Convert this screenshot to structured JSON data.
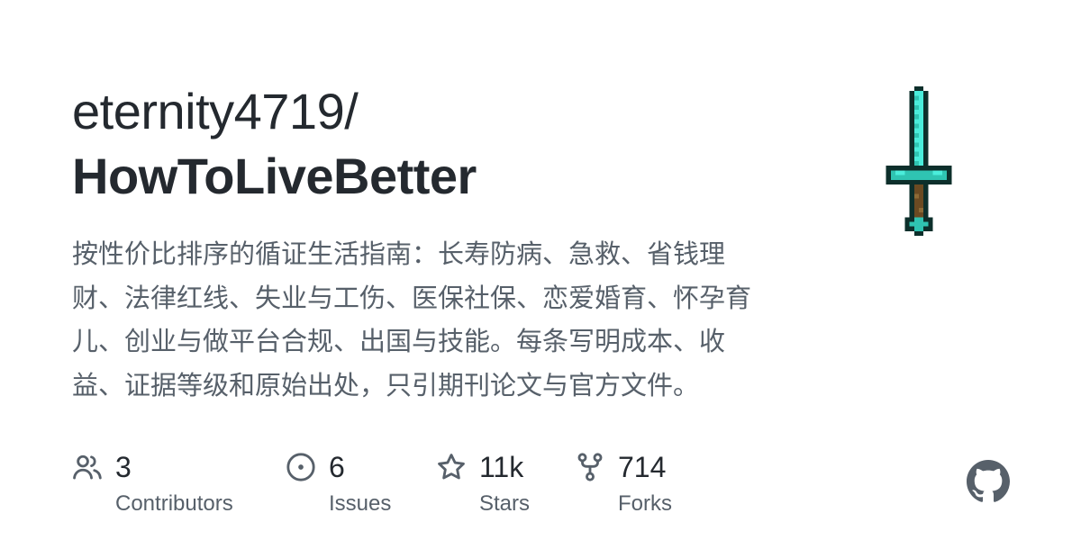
{
  "repo": {
    "owner": "eternity4719/",
    "name": "HowToLiveBetter",
    "description": "按性价比排序的循证生活指南：长寿防病、急救、省钱理财、法律红线、失业与工伤、医保社保、恋爱婚育、怀孕育儿、创业与做平台合规、出国与技能。每条写明成本、收益、证据等级和原始出处，只引期刊论文与官方文件。"
  },
  "stats": [
    {
      "icon": "people-icon",
      "count": "3",
      "label": "Contributors"
    },
    {
      "icon": "issue-opened-icon",
      "count": "6",
      "label": "Issues"
    },
    {
      "icon": "star-icon",
      "count": "11k",
      "label": "Stars"
    },
    {
      "icon": "repo-forked-icon",
      "count": "714",
      "label": "Forks"
    }
  ],
  "colors": {
    "text_primary": "#24292f",
    "text_secondary": "#57606a",
    "icon": "#57606a",
    "sword_blade": "#4aeddb",
    "sword_outline": "#0d2f2b",
    "sword_handle": "#6b4a22"
  },
  "images": {
    "repo_avatar": "diamond-sword-pixel-art",
    "platform_logo": "github-mark-icon"
  }
}
